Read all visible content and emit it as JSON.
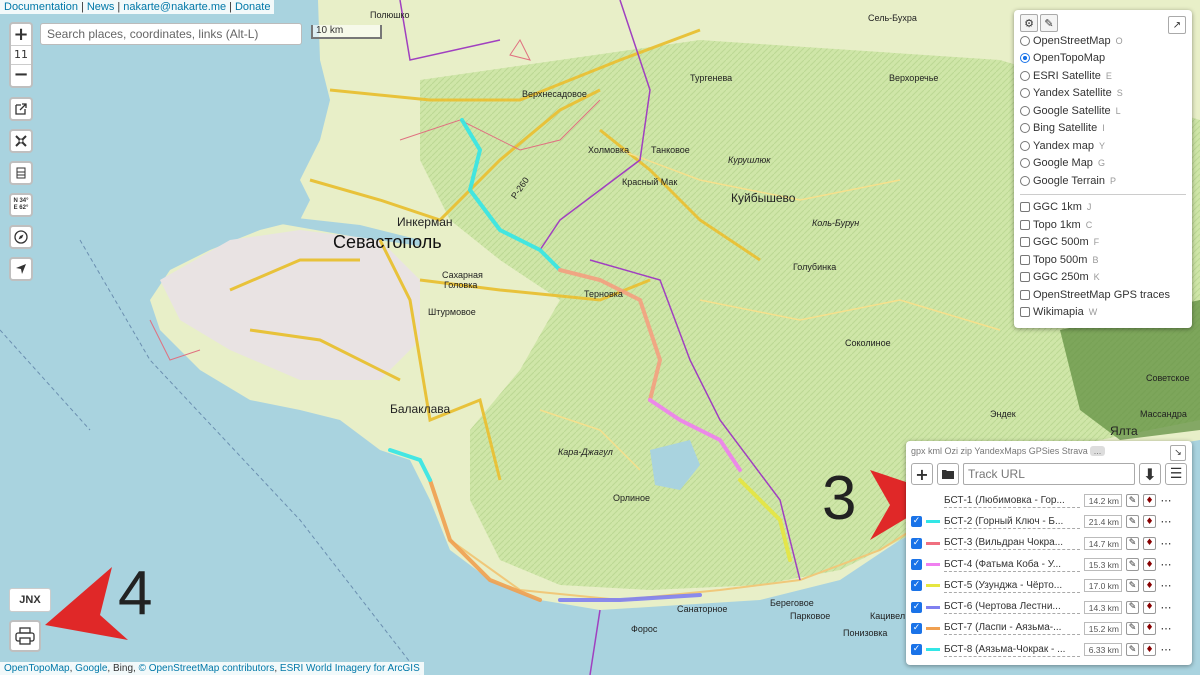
{
  "top_links": [
    "Documentation",
    "News",
    "nakarte@nakarte.me",
    "Donate"
  ],
  "zoom": {
    "plus": "+",
    "level": "11",
    "minus": "−"
  },
  "left_tools": [
    {
      "icon": "external-link-icon"
    },
    {
      "icon": "crossed-tools-icon"
    },
    {
      "icon": "elevation-profile-icon"
    },
    {
      "icon": "coordinates-icon",
      "text1": "N 34°",
      "text2": "E 62°"
    },
    {
      "icon": "compass-icon"
    },
    {
      "icon": "locate-arrow-icon"
    }
  ],
  "search": {
    "placeholder": "Search places, coordinates, links (Alt-L)"
  },
  "scale": {
    "label": "10 km"
  },
  "layers": {
    "base": [
      {
        "label": "OpenStreetMap",
        "key": "O",
        "selected": false
      },
      {
        "label": "OpenTopoMap",
        "key": "",
        "selected": true
      },
      {
        "label": "ESRI Satellite",
        "key": "E",
        "selected": false
      },
      {
        "label": "Yandex Satellite",
        "key": "S",
        "selected": false
      },
      {
        "label": "Google Satellite",
        "key": "L",
        "selected": false
      },
      {
        "label": "Bing Satellite",
        "key": "I",
        "selected": false
      },
      {
        "label": "Yandex map",
        "key": "Y",
        "selected": false
      },
      {
        "label": "Google Map",
        "key": "G",
        "selected": false
      },
      {
        "label": "Google Terrain",
        "key": "P",
        "selected": false
      }
    ],
    "overlays": [
      {
        "label": "GGC 1km",
        "key": "J"
      },
      {
        "label": "Topo 1km",
        "key": "C"
      },
      {
        "label": "GGC 500m",
        "key": "F"
      },
      {
        "label": "Topo 500m",
        "key": "B"
      },
      {
        "label": "GGC 250m",
        "key": "K"
      },
      {
        "label": "OpenStreetMap GPS traces",
        "key": ""
      },
      {
        "label": "Wikimapia",
        "key": "W"
      }
    ]
  },
  "tracks": {
    "formats": "gpx kml Ozi zip YandexMaps GPSies Strava",
    "more": "...",
    "url_placeholder": "Track URL",
    "items": [
      {
        "name": "БСТ-1 (Любимовка - Гор...",
        "length": "14.2 km",
        "color": "#ffffff",
        "checked": false
      },
      {
        "name": "БСТ-2 (Горный Ключ - Б...",
        "length": "21.4 km",
        "color": "#33e6e6",
        "checked": true
      },
      {
        "name": "БСТ-3 (Вильдран Чокра...",
        "length": "14.7 km",
        "color": "#f07080",
        "checked": true
      },
      {
        "name": "БСТ-4 (Фатьма Коба - У...",
        "length": "15.3 km",
        "color": "#f080f0",
        "checked": true
      },
      {
        "name": "БСТ-5 (Узунджа - Чёрто...",
        "length": "17.0 km",
        "color": "#e6e640",
        "checked": true
      },
      {
        "name": "БСТ-6 (Чертова Лестни...",
        "length": "14.3 km",
        "color": "#8080f0",
        "checked": true
      },
      {
        "name": "БСТ-7 (Ласпи - Аязьма-...",
        "length": "15.2 km",
        "color": "#f0a050",
        "checked": true
      },
      {
        "name": "БСТ-8 (Аязьма-Чокрак - ...",
        "length": "6.33 km",
        "color": "#33e6e6",
        "checked": true
      }
    ]
  },
  "annotations": {
    "three": "3",
    "four": "4"
  },
  "jnx": "JNX",
  "attribution": {
    "otm": "OpenTopoMap",
    "google": "Google",
    "bing": "Bing",
    "osm": "© OpenStreetMap contributors",
    "esri": "ESRI World Imagery for ArcGIS"
  },
  "map_labels": {
    "sevastopol": "Севастополь",
    "balaklava": "Балаклава",
    "inkerman": "Инкерман",
    "kuibyshevo": "Куйбышево",
    "kholmovka": "Холмовка",
    "tankovoe": "Танковое",
    "krasny_mak": "Красный Мак",
    "ternovka": "Терновка",
    "shturmovoe": "Штурмовое",
    "sakharnaya": "Сахарная",
    "golovka": "Головка",
    "foros": "Форос",
    "sanatornoe": "Санаторное",
    "beregovoe": "Береговое",
    "parkovoe": "Парковое",
    "ponizovka": "Понизовка",
    "katsiveli": "Кацивел",
    "orlinoe": "Орлиное",
    "sokolinoe": "Соколиное",
    "golubinka": "Голубинка",
    "turgeneva": "Тургенева",
    "verkhnesadovoe": "Верхнесадовое",
    "polyushko": "Полюшко",
    "sel_bukhra": "Сель-Бухра",
    "verkhorechye": "Верхоречье",
    "kurushlyuk": "Курушлюк",
    "kol_burun": "Коль-Бурун",
    "kara_dzhagul": "Кара-Джагул",
    "sovetskoe": "Советское",
    "massandra": "Массандра",
    "yalta": "Ялта",
    "endek": "Эндек",
    "road_p260": "Р-260"
  }
}
